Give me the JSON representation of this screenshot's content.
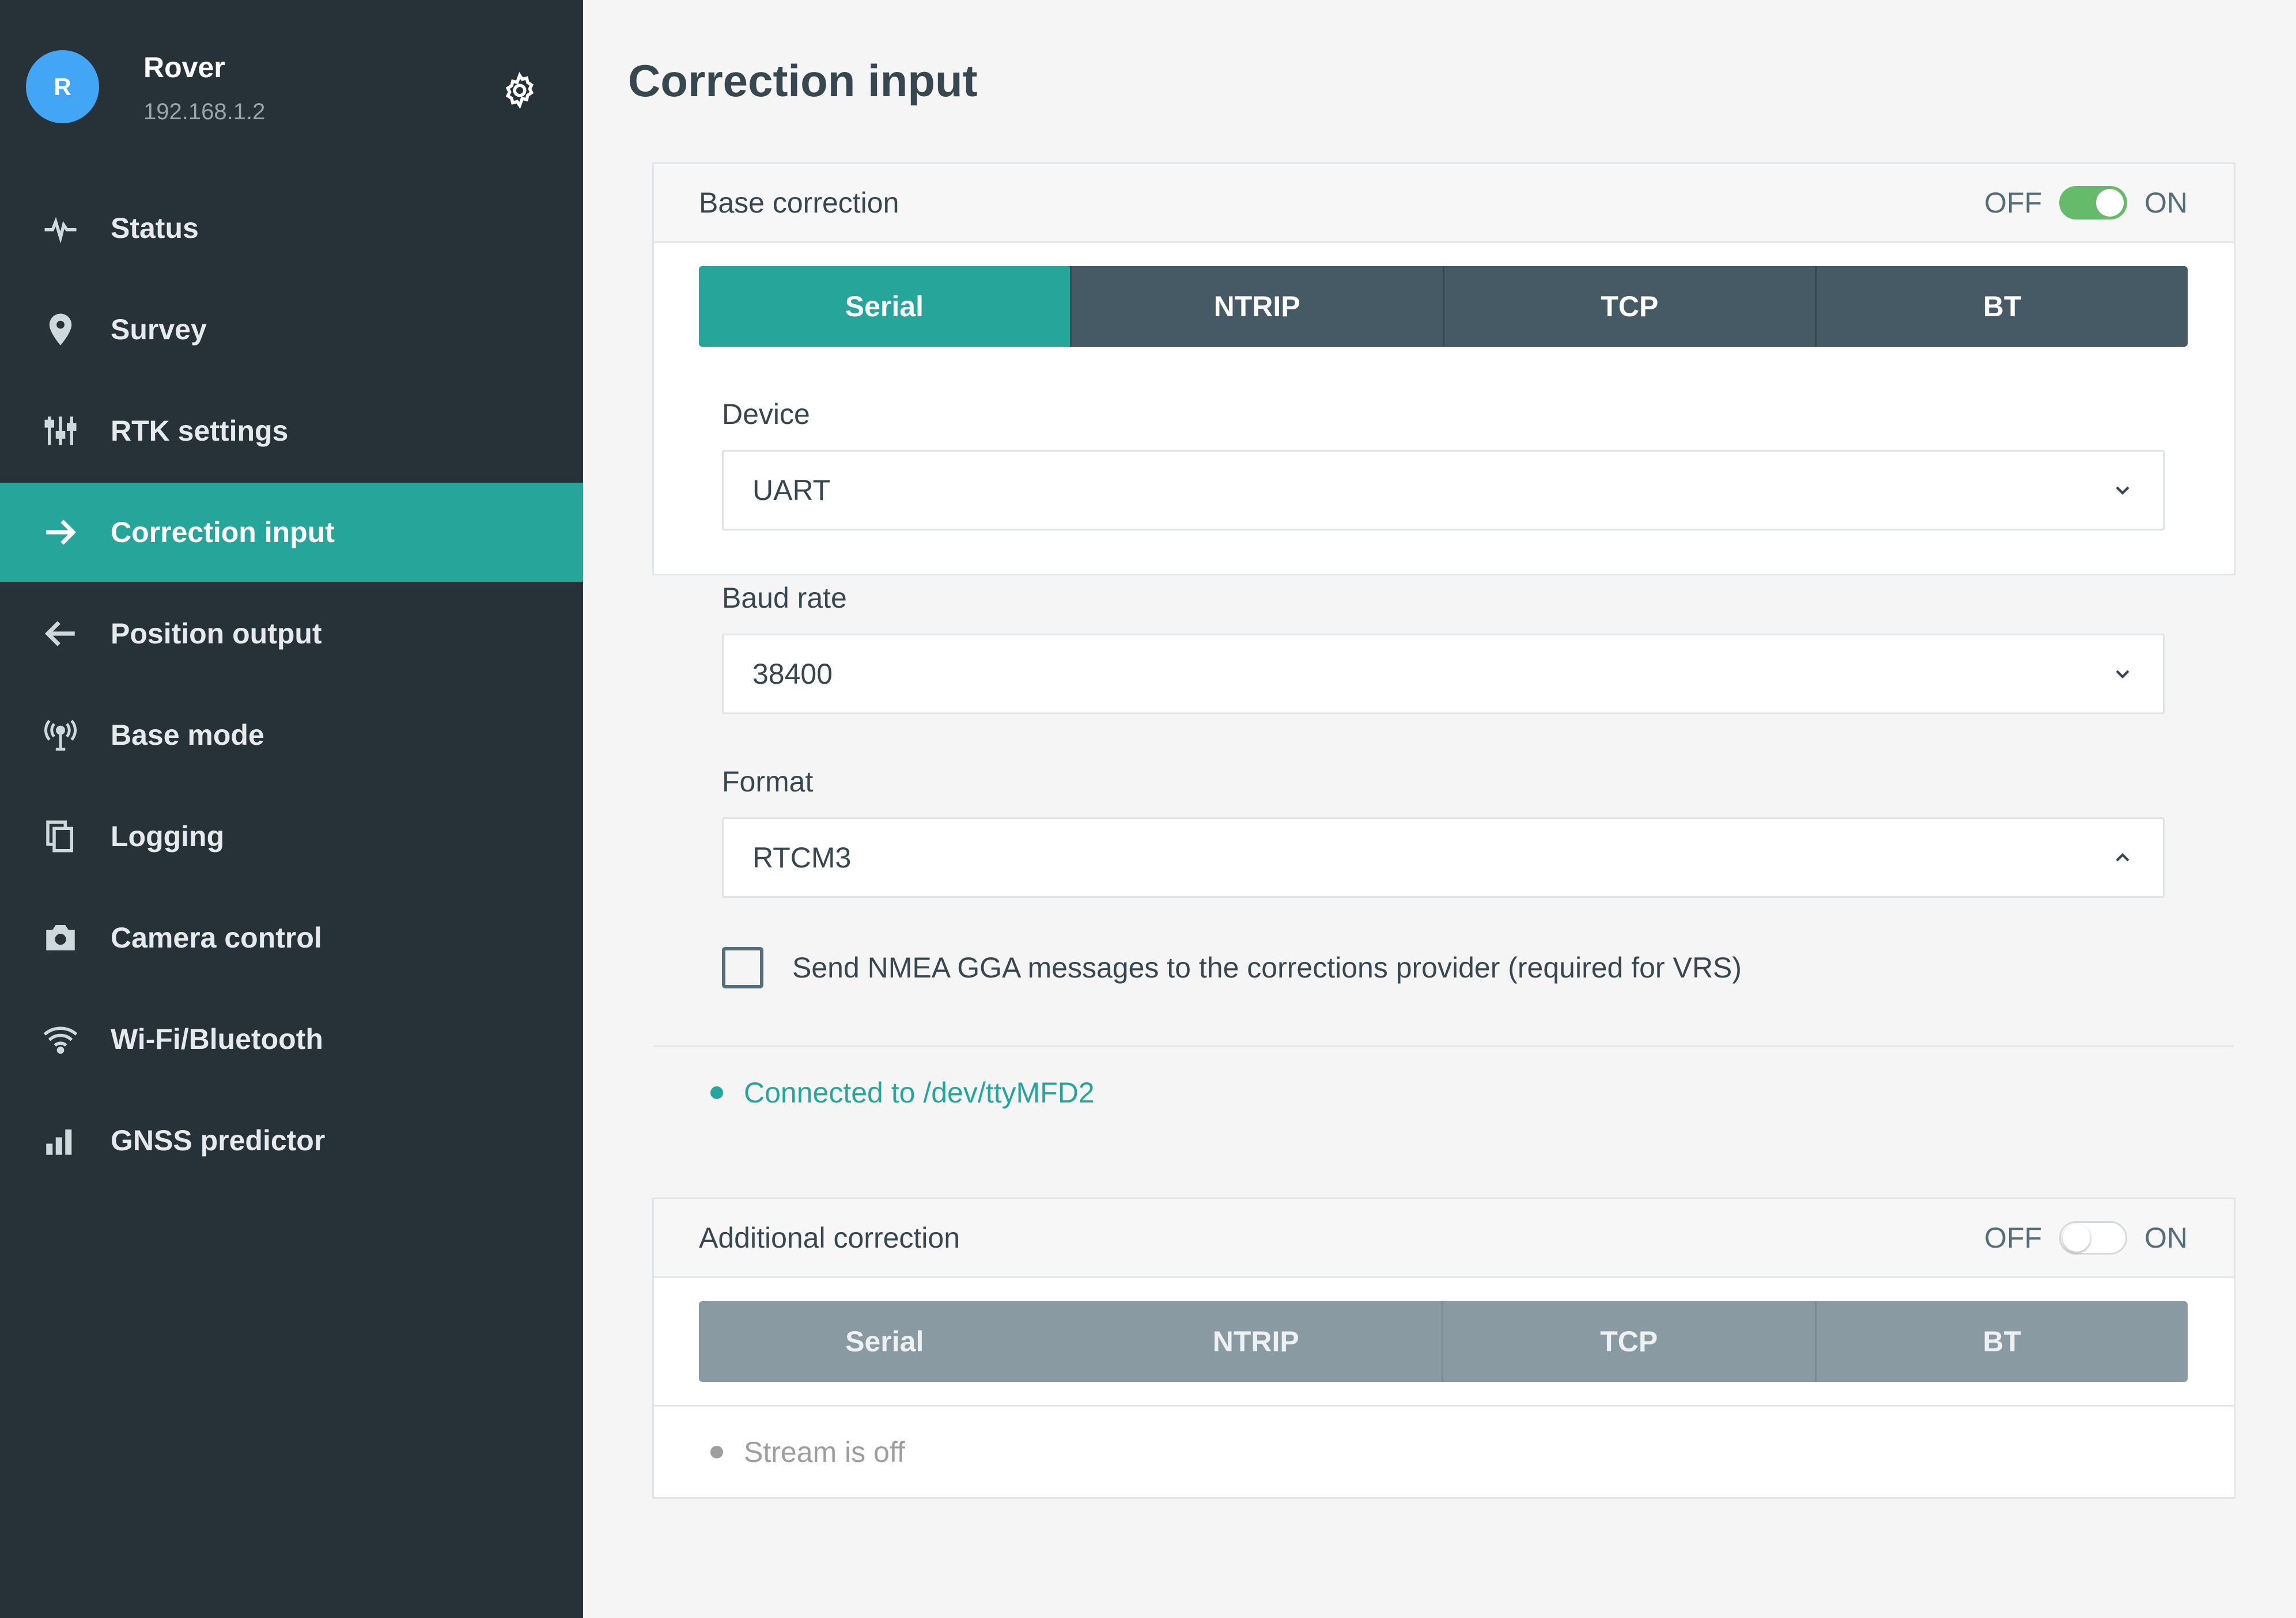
{
  "device": {
    "avatar_letter": "R",
    "name": "Rover",
    "ip": "192.168.1.2"
  },
  "nav": {
    "items": [
      {
        "label": "Status",
        "icon": "pulse-icon"
      },
      {
        "label": "Survey",
        "icon": "map-pin-icon"
      },
      {
        "label": "RTK settings",
        "icon": "sliders-icon"
      },
      {
        "label": "Correction input",
        "icon": "arrow-right-icon",
        "active": true
      },
      {
        "label": "Position output",
        "icon": "arrow-left-icon"
      },
      {
        "label": "Base mode",
        "icon": "antenna-icon"
      },
      {
        "label": "Logging",
        "icon": "files-icon"
      },
      {
        "label": "Camera control",
        "icon": "camera-icon"
      },
      {
        "label": "Wi-Fi/Bluetooth",
        "icon": "wifi-icon"
      },
      {
        "label": "GNSS predictor",
        "icon": "bar-chart-icon"
      }
    ]
  },
  "page": {
    "title": "Correction input"
  },
  "base_correction": {
    "title": "Base correction",
    "toggle": {
      "off_label": "OFF",
      "on_label": "ON",
      "state": "on"
    },
    "tabs": [
      "Serial",
      "NTRIP",
      "TCP",
      "BT"
    ],
    "active_tab": "Serial",
    "device": {
      "label": "Device",
      "value": "UART"
    },
    "baud_rate": {
      "label": "Baud rate",
      "value": "38400"
    },
    "format": {
      "label": "Format",
      "value": "RTCM3"
    },
    "send_gga": {
      "label": "Send NMEA GGA messages to the corrections provider (required for VRS)",
      "checked": false
    },
    "status": {
      "text": "Connected to /dev/ttyMFD2",
      "color": "#26a69a"
    }
  },
  "additional_correction": {
    "title": "Additional correction",
    "toggle": {
      "off_label": "OFF",
      "on_label": "ON",
      "state": "off"
    },
    "tabs": [
      "Serial",
      "NTRIP",
      "TCP",
      "BT"
    ],
    "status": {
      "text": "Stream is off",
      "color": "#9e9e9e"
    }
  },
  "colors": {
    "sidebar": "#263238",
    "accent": "#26a69a",
    "switch_on": "#66bb6a",
    "avatar": "#42a5f5"
  }
}
